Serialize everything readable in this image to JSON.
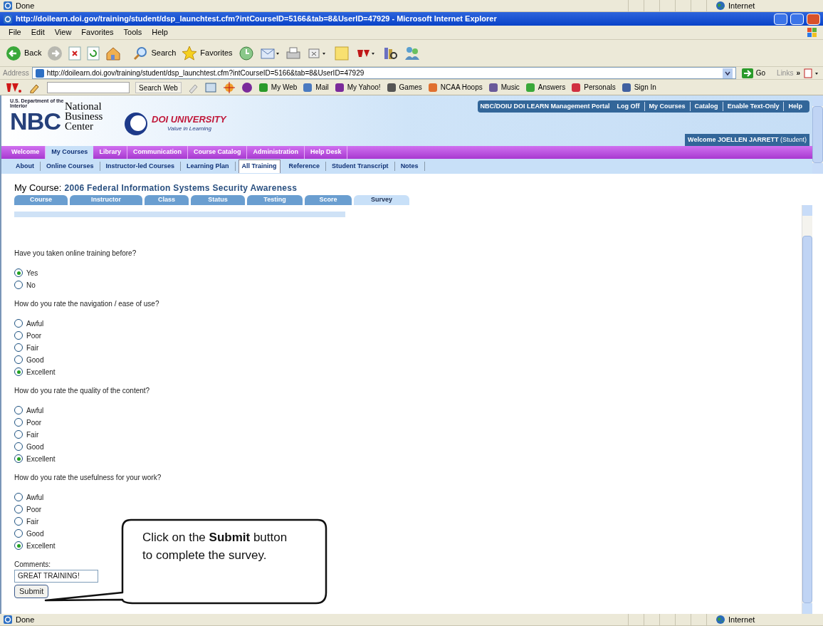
{
  "top_status": {
    "text": "Done",
    "zone": "Internet"
  },
  "window": {
    "title": "http://doilearn.doi.gov/training/student/dsp_launchtest.cfm?intCourseID=5166&tab=8&UserID=47929 - Microsoft Internet Explorer"
  },
  "menu": [
    "File",
    "Edit",
    "View",
    "Favorites",
    "Tools",
    "Help"
  ],
  "toolbar": {
    "back": "Back",
    "search": "Search",
    "favorites": "Favorites"
  },
  "address": {
    "label": "Address",
    "url": "http://doilearn.doi.gov/training/student/dsp_launchtest.cfm?intCourseID=5166&tab=8&UserID=47929",
    "go": "Go",
    "links": "Links",
    "more": "»"
  },
  "yahoo_bar": {
    "search_button": "Search Web",
    "items": [
      "My Web",
      "Mail",
      "My Yahoo!",
      "Games",
      "NCAA Hoops",
      "Music",
      "Answers",
      "Personals",
      "Sign In"
    ]
  },
  "header": {
    "dept": "U.S. Department of the Interior",
    "nbc": "NBC",
    "org": "National Business Center",
    "univ": "DOI UNIVERSITY",
    "tagline": "Value in Learning",
    "portal": "NBC/DOIU DOI LEARN Management Portal",
    "links": [
      "Log Off",
      "My Courses",
      "Catalog",
      "Enable Text-Only",
      "Help"
    ],
    "welcome": "**Welcome JOELLEN JARRETT** (Student)"
  },
  "nav": [
    {
      "label": "Welcome",
      "selected": false
    },
    {
      "label": "My Courses",
      "selected": true
    },
    {
      "label": "Library",
      "selected": false
    },
    {
      "label": "Communication",
      "selected": false
    },
    {
      "label": "Course Catalog",
      "selected": false
    },
    {
      "label": "Administration",
      "selected": false
    },
    {
      "label": "Help Desk",
      "selected": false
    }
  ],
  "subnav": [
    {
      "label": "About",
      "selected": false
    },
    {
      "label": "Online Courses",
      "selected": false
    },
    {
      "label": "Instructor-led Courses",
      "selected": false
    },
    {
      "label": "Learning Plan",
      "selected": false
    },
    {
      "label": "All Training",
      "selected": true
    },
    {
      "label": "Reference",
      "selected": false
    },
    {
      "label": "Student Transcript",
      "selected": false
    },
    {
      "label": "Notes",
      "selected": false
    }
  ],
  "course": {
    "label": "My Course:",
    "title": "2006 Federal Information Systems Security Awareness"
  },
  "course_tabs": [
    {
      "label": "Course",
      "selected": false
    },
    {
      "label": "Instructor",
      "selected": false
    },
    {
      "label": "Class",
      "selected": false
    },
    {
      "label": "Status",
      "selected": false
    },
    {
      "label": "Testing",
      "selected": false
    },
    {
      "label": "Score",
      "selected": false
    },
    {
      "label": "Survey",
      "selected": true
    }
  ],
  "questions": [
    {
      "text": "Have you taken online training before?",
      "options": [
        {
          "label": "Yes",
          "selected": true
        },
        {
          "label": "No",
          "selected": false
        }
      ]
    },
    {
      "text": "How do you rate the navigation / ease of use?",
      "options": [
        {
          "label": "Awful",
          "selected": false
        },
        {
          "label": "Poor",
          "selected": false
        },
        {
          "label": "Fair",
          "selected": false
        },
        {
          "label": "Good",
          "selected": false
        },
        {
          "label": "Excellent",
          "selected": true
        }
      ]
    },
    {
      "text": "How do you rate the quality of the content?",
      "options": [
        {
          "label": "Awful",
          "selected": false
        },
        {
          "label": "Poor",
          "selected": false
        },
        {
          "label": "Fair",
          "selected": false
        },
        {
          "label": "Good",
          "selected": false
        },
        {
          "label": "Excellent",
          "selected": true
        }
      ]
    },
    {
      "text": "How do you rate the usefulness for your work?",
      "options": [
        {
          "label": "Awful",
          "selected": false
        },
        {
          "label": "Poor",
          "selected": false
        },
        {
          "label": "Fair",
          "selected": false
        },
        {
          "label": "Good",
          "selected": false
        },
        {
          "label": "Excellent",
          "selected": true
        }
      ]
    }
  ],
  "comments": {
    "label": "Comments:",
    "value": "GREAT TRAINING!"
  },
  "submit": "Submit",
  "callout": "Click on the **Submit** button to complete the survey.",
  "status_bar": {
    "text": "Done",
    "zone": "Internet"
  }
}
